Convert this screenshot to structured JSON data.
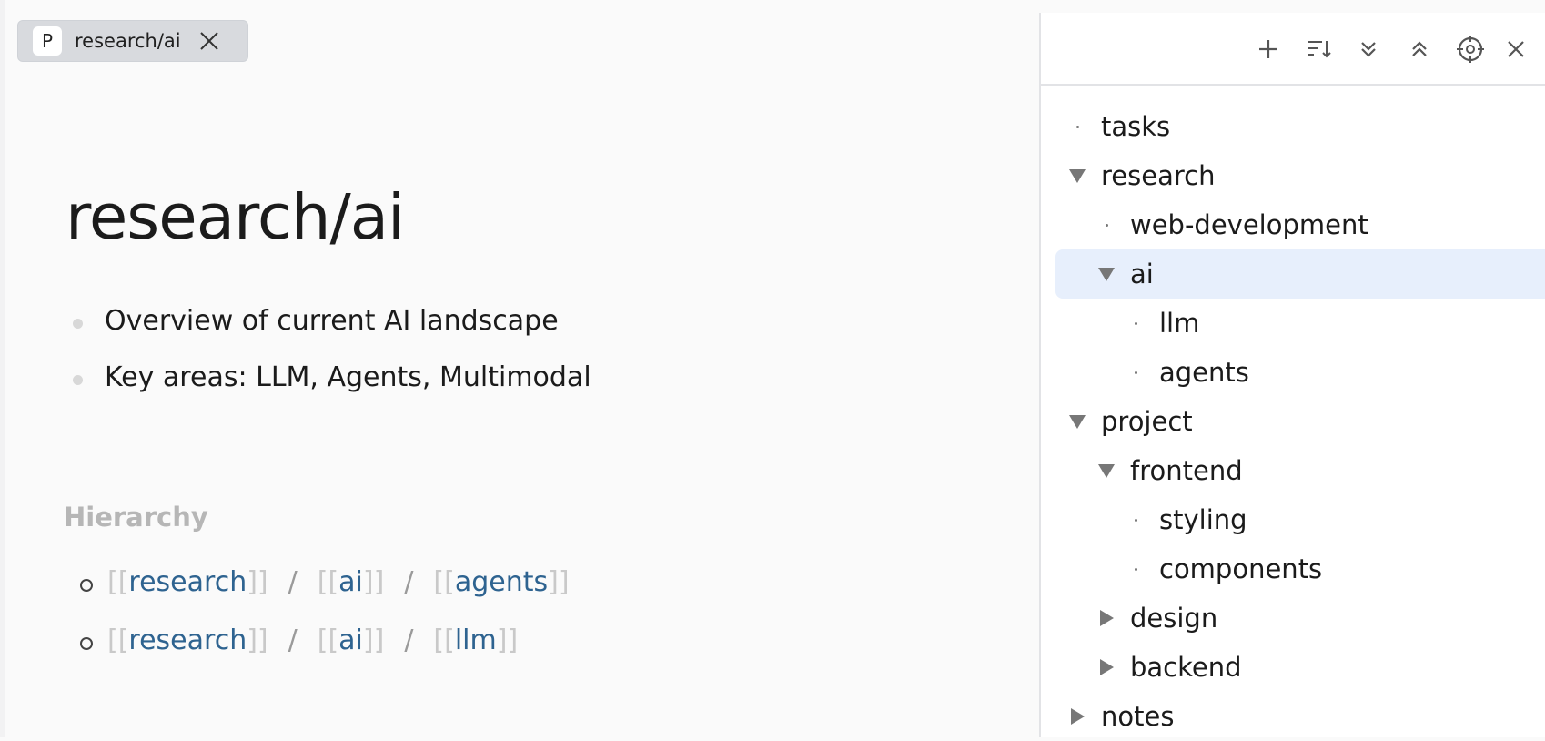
{
  "tab": {
    "icon_letter": "P",
    "title": "research/ai"
  },
  "page": {
    "title": "research/ai",
    "blocks": [
      "Overview of current AI landscape",
      "Key areas: LLM, Agents, Multimodal"
    ]
  },
  "hierarchy": {
    "title": "Hierarchy",
    "separator": "/",
    "open_bracket": "[[",
    "close_bracket": "]]",
    "paths": [
      [
        "research",
        "ai",
        "agents"
      ],
      [
        "research",
        "ai",
        "llm"
      ]
    ]
  },
  "sidebar": {
    "toolbar_icons": [
      "add-icon",
      "sort-icon",
      "expand-all-icon",
      "collapse-all-icon",
      "locate-icon",
      "close-icon"
    ],
    "tree": [
      {
        "label": "tasks",
        "depth": 0,
        "state": "leaf"
      },
      {
        "label": "research",
        "depth": 0,
        "state": "expanded"
      },
      {
        "label": "web-development",
        "depth": 1,
        "state": "leaf"
      },
      {
        "label": "ai",
        "depth": 1,
        "state": "expanded",
        "selected": true
      },
      {
        "label": "llm",
        "depth": 2,
        "state": "leaf"
      },
      {
        "label": "agents",
        "depth": 2,
        "state": "leaf"
      },
      {
        "label": "project",
        "depth": 0,
        "state": "expanded"
      },
      {
        "label": "frontend",
        "depth": 1,
        "state": "expanded"
      },
      {
        "label": "styling",
        "depth": 2,
        "state": "leaf"
      },
      {
        "label": "components",
        "depth": 2,
        "state": "leaf"
      },
      {
        "label": "design",
        "depth": 1,
        "state": "collapsed"
      },
      {
        "label": "backend",
        "depth": 1,
        "state": "collapsed"
      },
      {
        "label": "notes",
        "depth": 0,
        "state": "collapsed"
      }
    ]
  },
  "colors": {
    "link": "#2e6390",
    "selected_row": "#e7effc",
    "bracket": "#c9c9c9"
  }
}
